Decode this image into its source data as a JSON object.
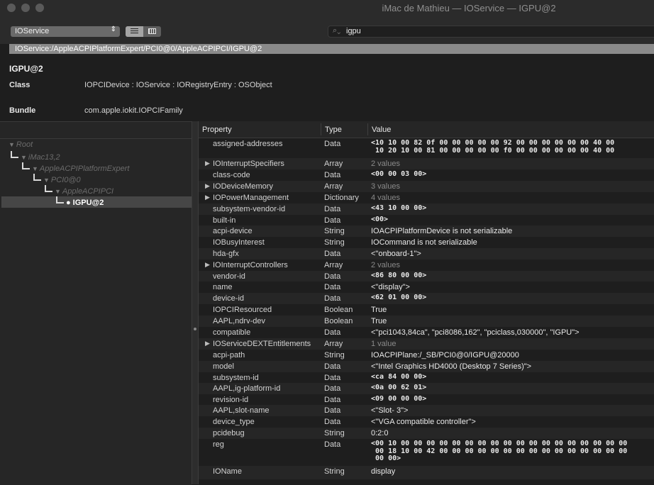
{
  "window": {
    "title": "iMac de Mathieu — IOService — IGPU@2"
  },
  "toolbar": {
    "plane": "IOService",
    "search_value": "igpu"
  },
  "path": "IOService:/AppleACPIPlatformExpert/PCI0@0/AppleACPIPCI/IGPU@2",
  "info": {
    "object_name": "IGPU@2",
    "class_label": "Class",
    "class_value": "IOPCIDevice : IOService : IORegistryEntry : OSObject",
    "bundle_label": "Bundle",
    "bundle_value": "com.apple.iokit.IOPCIFamily"
  },
  "tree": {
    "nodes": [
      "Root",
      "iMac13,2",
      "AppleACPIPlatformExpert",
      "PCI0@0",
      "AppleACPIPCI",
      "IGPU@2"
    ]
  },
  "table": {
    "headers": {
      "property": "Property",
      "type": "Type",
      "value": "Value"
    },
    "rows": [
      {
        "property": "assigned-addresses",
        "type": "Data",
        "value": "<10 10 00 82 0f 00 00 00 00 00 92 00 00 00 00 00 00 40 00\n 10 20 10 00 81 00 00 00 00 00 f0 00 00 00 00 00 00 40 00",
        "expandable": false,
        "dim": false,
        "mono": true
      },
      {
        "property": "IOInterruptSpecifiers",
        "type": "Array",
        "value": "2 values",
        "expandable": true,
        "dim": true,
        "mono": false
      },
      {
        "property": "class-code",
        "type": "Data",
        "value": "<00 00 03 00>",
        "expandable": false,
        "dim": false,
        "mono": true
      },
      {
        "property": "IODeviceMemory",
        "type": "Array",
        "value": "3 values",
        "expandable": true,
        "dim": true,
        "mono": false
      },
      {
        "property": "IOPowerManagement",
        "type": "Dictionary",
        "value": "4 values",
        "expandable": true,
        "dim": true,
        "mono": false
      },
      {
        "property": "subsystem-vendor-id",
        "type": "Data",
        "value": "<43 10 00 00>",
        "expandable": false,
        "dim": false,
        "mono": true
      },
      {
        "property": "built-in",
        "type": "Data",
        "value": "<00>",
        "expandable": false,
        "dim": false,
        "mono": true
      },
      {
        "property": "acpi-device",
        "type": "String",
        "value": "IOACPIPlatformDevice is not serializable",
        "expandable": false,
        "dim": false,
        "mono": false
      },
      {
        "property": "IOBusyInterest",
        "type": "String",
        "value": "IOCommand is not serializable",
        "expandable": false,
        "dim": false,
        "mono": false
      },
      {
        "property": "hda-gfx",
        "type": "Data",
        "value": "<\"onboard-1\">",
        "expandable": false,
        "dim": false,
        "mono": false
      },
      {
        "property": "IOInterruptControllers",
        "type": "Array",
        "value": "2 values",
        "expandable": true,
        "dim": true,
        "mono": false
      },
      {
        "property": "vendor-id",
        "type": "Data",
        "value": "<86 80 00 00>",
        "expandable": false,
        "dim": false,
        "mono": true
      },
      {
        "property": "name",
        "type": "Data",
        "value": "<\"display\">",
        "expandable": false,
        "dim": false,
        "mono": false
      },
      {
        "property": "device-id",
        "type": "Data",
        "value": "<62 01 00 00>",
        "expandable": false,
        "dim": false,
        "mono": true
      },
      {
        "property": "IOPCIResourced",
        "type": "Boolean",
        "value": "True",
        "expandable": false,
        "dim": false,
        "mono": false
      },
      {
        "property": "AAPL,ndrv-dev",
        "type": "Boolean",
        "value": "True",
        "expandable": false,
        "dim": false,
        "mono": false
      },
      {
        "property": "compatible",
        "type": "Data",
        "value": "<\"pci1043,84ca\", \"pci8086,162\", \"pciclass,030000\", \"IGPU\">",
        "expandable": false,
        "dim": false,
        "mono": false
      },
      {
        "property": "IOServiceDEXTEntitlements",
        "type": "Array",
        "value": "1 value",
        "expandable": true,
        "dim": true,
        "mono": false
      },
      {
        "property": "acpi-path",
        "type": "String",
        "value": "IOACPIPlane:/_SB/PCI0@0/IGPU@20000",
        "expandable": false,
        "dim": false,
        "mono": false
      },
      {
        "property": "model",
        "type": "Data",
        "value": "<\"Intel Graphics HD4000 (Desktop 7 Series)\">",
        "expandable": false,
        "dim": false,
        "mono": false
      },
      {
        "property": "subsystem-id",
        "type": "Data",
        "value": "<ca 84 00 00>",
        "expandable": false,
        "dim": false,
        "mono": true
      },
      {
        "property": "AAPL,ig-platform-id",
        "type": "Data",
        "value": "<0a 00 62 01>",
        "expandable": false,
        "dim": false,
        "mono": true
      },
      {
        "property": "revision-id",
        "type": "Data",
        "value": "<09 00 00 00>",
        "expandable": false,
        "dim": false,
        "mono": true
      },
      {
        "property": "AAPL,slot-name",
        "type": "Data",
        "value": "<\"Slot- 3\">",
        "expandable": false,
        "dim": false,
        "mono": false
      },
      {
        "property": "device_type",
        "type": "Data",
        "value": "<\"VGA compatible controller\">",
        "expandable": false,
        "dim": false,
        "mono": false
      },
      {
        "property": "pcidebug",
        "type": "String",
        "value": "0:2:0",
        "expandable": false,
        "dim": false,
        "mono": false
      },
      {
        "property": "reg",
        "type": "Data",
        "value": "<00 10 00 00 00 00 00 00 00 00 00 00 00 00 00 00 00 00 00 00\n 00 18 10 00 42 00 00 00 00 00 00 00 00 00 00 00 00 00 00 00\n 00 00>",
        "expandable": false,
        "dim": false,
        "mono": true
      },
      {
        "property": "IOName",
        "type": "String",
        "value": "display",
        "expandable": false,
        "dim": false,
        "mono": false
      }
    ]
  }
}
